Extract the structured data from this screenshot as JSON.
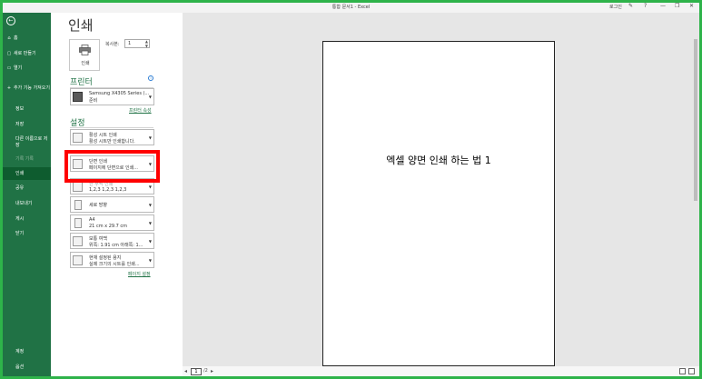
{
  "window": {
    "title": "통합 문서1  -  Excel",
    "login": "로그인",
    "controls": [
      "?",
      "—",
      "❐",
      "✕"
    ]
  },
  "sidebar": {
    "back": "←",
    "items": [
      {
        "label": "홈",
        "icon": "home-icon",
        "glyph": "⌂"
      },
      {
        "label": "새로 만들기",
        "icon": "new-file-icon",
        "glyph": "▢"
      },
      {
        "label": "열기",
        "icon": "open-folder-icon",
        "glyph": "▭"
      },
      {
        "label": "추가 기능 가져오기",
        "icon": "add-in-icon",
        "glyph": "+"
      },
      {
        "label": "정보"
      },
      {
        "label": "저장"
      },
      {
        "label": "다른 이름으로 저장"
      },
      {
        "label": "기록 기록"
      },
      {
        "label": "인쇄"
      },
      {
        "label": "공유"
      },
      {
        "label": "내보내기"
      },
      {
        "label": "게시"
      },
      {
        "label": "닫기"
      }
    ],
    "bottom": [
      "계정",
      "옵션"
    ]
  },
  "print": {
    "title": "인쇄",
    "button_label": "인쇄",
    "copies_label": "복사본:",
    "copies_value": "1",
    "printer_header": "프린터",
    "printer_name": "Samsung X4305 Series (...",
    "printer_status": "준비",
    "printer_props_link": "프린터 속성",
    "settings_header": "설정",
    "settings": [
      {
        "line1": "활성 시트 인쇄",
        "line2": "활성 시트만 인쇄합니다."
      },
      {
        "line1": "단면 인쇄",
        "line2": "페이지에 단면으로 인쇄..."
      },
      {
        "line1": "한 부씩 인쇄",
        "line2": "1,2,3    1,2,3    1,2,3"
      },
      {
        "line1": "세로 방향",
        "line2": ""
      },
      {
        "line1": "A4",
        "line2": "21 cm x 29.7 cm"
      },
      {
        "line1": "보통 여백",
        "line2": "위쪽: 1.91 cm 아래쪽: 1..."
      },
      {
        "line1": "현재 설정된 용지",
        "line2": "실제 크기의 시트를 인쇄..."
      }
    ],
    "page_setup_link": "페이지 설정"
  },
  "preview": {
    "page_text": "엑셀 양면 인쇄 하는 법 1",
    "current_page": "1",
    "page_of": "/2",
    "prev": "◂",
    "next": "▸"
  },
  "colors": {
    "sidebar": "#207245",
    "accent": "#217346",
    "highlight": "#ff0000",
    "frame": "#2eb34a"
  }
}
